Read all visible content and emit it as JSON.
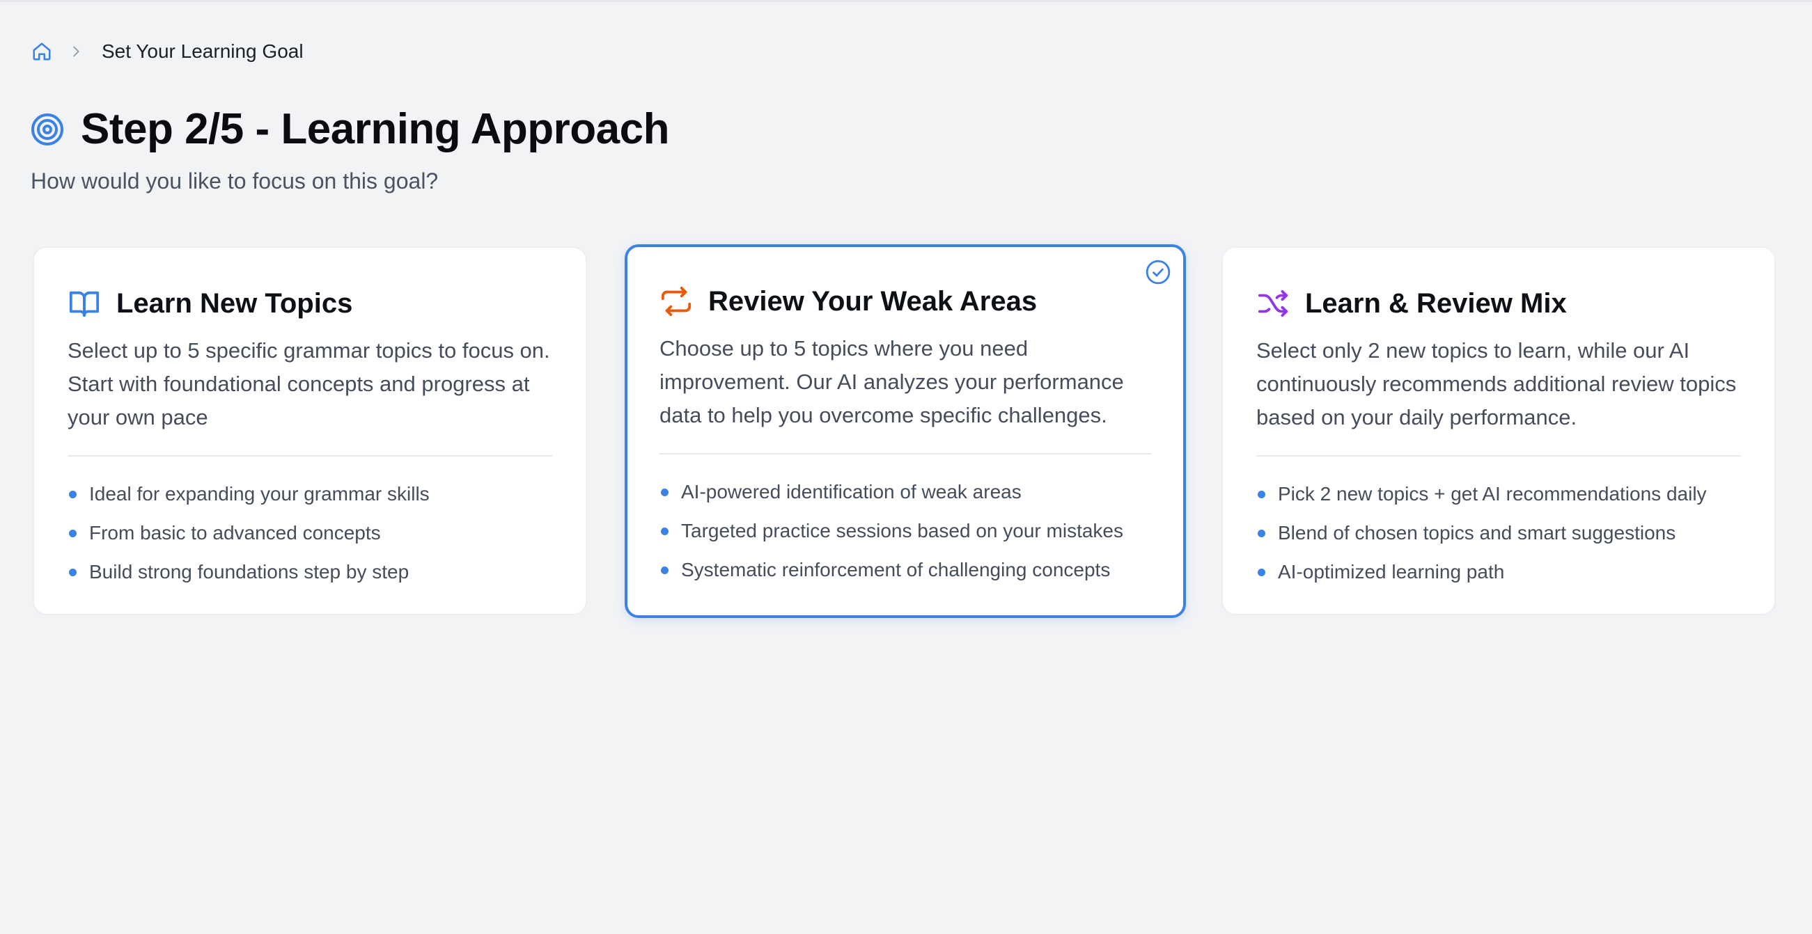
{
  "breadcrumb": {
    "home_icon": "home-icon",
    "separator_icon": "chevron-right-icon",
    "current": "Set Your Learning Goal"
  },
  "header": {
    "icon": "target-icon",
    "title": "Step 2/5 - Learning Approach",
    "subtitle": "How would you like to focus on this goal?"
  },
  "colors": {
    "accent": "#3b82e6",
    "review_icon": "#ea5a0c",
    "mix_icon": "#9333ea",
    "background": "#f2f3f5"
  },
  "options": [
    {
      "icon": "book-open-icon",
      "title": "Learn New Topics",
      "description": "Select up to 5 specific grammar topics to focus on. Start with foundational concepts and progress at your own pace",
      "features": [
        "Ideal for expanding your grammar skills",
        "From basic to advanced concepts",
        "Build strong foundations step by step"
      ],
      "selected": false
    },
    {
      "icon": "repeat-icon",
      "title": "Review Your Weak Areas",
      "description": "Choose up to 5 topics where you need improvement. Our AI analyzes your performance data to help you overcome specific challenges.",
      "features": [
        "AI-powered identification of weak areas",
        "Targeted practice sessions based on your mistakes",
        "Systematic reinforcement of challenging concepts"
      ],
      "selected": true
    },
    {
      "icon": "shuffle-icon",
      "title": "Learn & Review Mix",
      "description": "Select only 2 new topics to learn, while our AI continuously recommends additional review topics based on your daily performance.",
      "features": [
        "Pick 2 new topics + get AI recommendations daily",
        "Blend of chosen topics and smart suggestions",
        "AI-optimized learning path"
      ],
      "selected": false
    }
  ]
}
